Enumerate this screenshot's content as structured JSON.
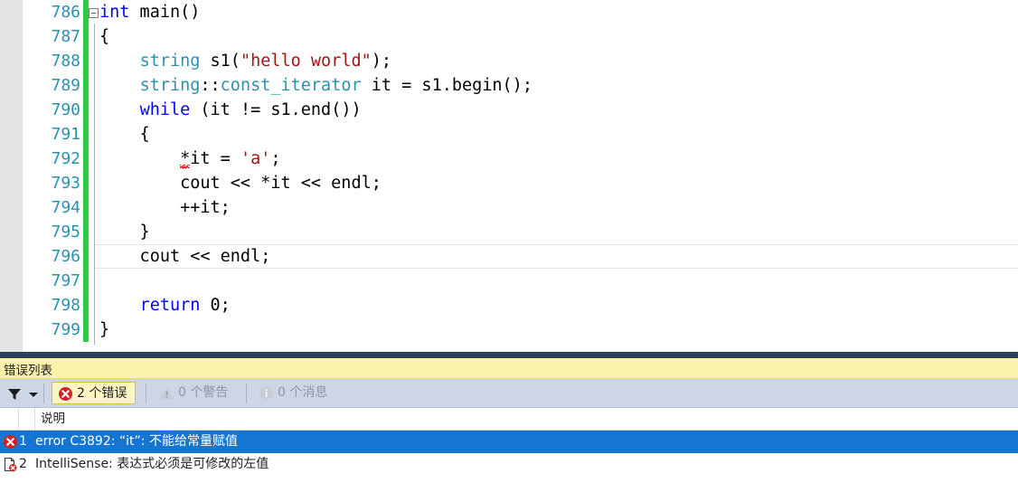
{
  "editor": {
    "name": "code-editor",
    "language": "cpp",
    "current_line": 796,
    "lines": [
      {
        "number": "786",
        "segments": [
          {
            "text": "int",
            "style": "kw"
          },
          {
            "text": " main()",
            "style": "plain"
          }
        ]
      },
      {
        "number": "787",
        "segments": [
          {
            "text": "{",
            "style": "plain"
          }
        ]
      },
      {
        "number": "788",
        "segments": [
          {
            "text": "    ",
            "style": "plain"
          },
          {
            "text": "string",
            "style": "type"
          },
          {
            "text": " s1(",
            "style": "plain"
          },
          {
            "text": "\"hello world\"",
            "style": "str"
          },
          {
            "text": ");",
            "style": "plain"
          }
        ]
      },
      {
        "number": "789",
        "segments": [
          {
            "text": "    ",
            "style": "plain"
          },
          {
            "text": "string",
            "style": "type"
          },
          {
            "text": "::",
            "style": "plain"
          },
          {
            "text": "const_iterator",
            "style": "type"
          },
          {
            "text": " it = s1.begin();",
            "style": "plain"
          }
        ]
      },
      {
        "number": "790",
        "segments": [
          {
            "text": "    ",
            "style": "plain"
          },
          {
            "text": "while",
            "style": "kw"
          },
          {
            "text": " (it != s1.end())",
            "style": "plain"
          }
        ]
      },
      {
        "number": "791",
        "segments": [
          {
            "text": "    {",
            "style": "plain"
          }
        ]
      },
      {
        "number": "792",
        "segments": [
          {
            "text": "        *it = ",
            "style": "plain"
          },
          {
            "text": "'a'",
            "style": "str"
          },
          {
            "text": ";",
            "style": "plain"
          }
        ]
      },
      {
        "number": "793",
        "segments": [
          {
            "text": "        cout << *it << endl;",
            "style": "plain"
          }
        ]
      },
      {
        "number": "794",
        "segments": [
          {
            "text": "        ++it;",
            "style": "plain"
          }
        ]
      },
      {
        "number": "795",
        "segments": [
          {
            "text": "    }",
            "style": "plain"
          }
        ]
      },
      {
        "number": "796",
        "segments": [
          {
            "text": "    cout << endl;",
            "style": "plain"
          }
        ]
      },
      {
        "number": "797",
        "segments": [
          {
            "text": "",
            "style": "plain"
          }
        ]
      },
      {
        "number": "798",
        "segments": [
          {
            "text": "    ",
            "style": "plain"
          },
          {
            "text": "return",
            "style": "kw"
          },
          {
            "text": " 0;",
            "style": "plain"
          }
        ]
      },
      {
        "number": "799",
        "segments": [
          {
            "text": "}",
            "style": "plain"
          }
        ]
      }
    ],
    "outline_marker": "collapse-minus"
  },
  "error_list": {
    "title": "错误列表",
    "toolbar": {
      "filter_icon": "filter-funnel-icon",
      "filter_caret": "chevron-down-icon",
      "errors_label": "2 个错误",
      "errors_icon": "error-circle-x-icon",
      "warnings_label": "0 个警告",
      "warnings_icon": "warning-triangle-icon",
      "messages_label": "0 个消息",
      "messages_icon": "info-circle-icon"
    },
    "columns": [
      "",
      "",
      "说明"
    ],
    "rows": [
      {
        "icon": "error-circle-x-icon",
        "index": "1",
        "description": "error C3892: “it”: 不能给常量赋值",
        "selected": true
      },
      {
        "icon": "intellisense-document-error-icon",
        "index": "2",
        "description": "IntelliSense: 表达式必须是可修改的左值",
        "selected": false
      }
    ]
  },
  "colors": {
    "keyword": "#0000FF",
    "type": "#2B91AF",
    "string": "#A31515",
    "line_number": "#2B91AF",
    "change_bar": "#2ECC40",
    "panel_title_bg": "#FDF2AA",
    "toolbar_bg": "#CED5E4",
    "row_selected_bg": "#1675D1",
    "separator_bar": "#2D4158",
    "error_red": "#D32020"
  }
}
